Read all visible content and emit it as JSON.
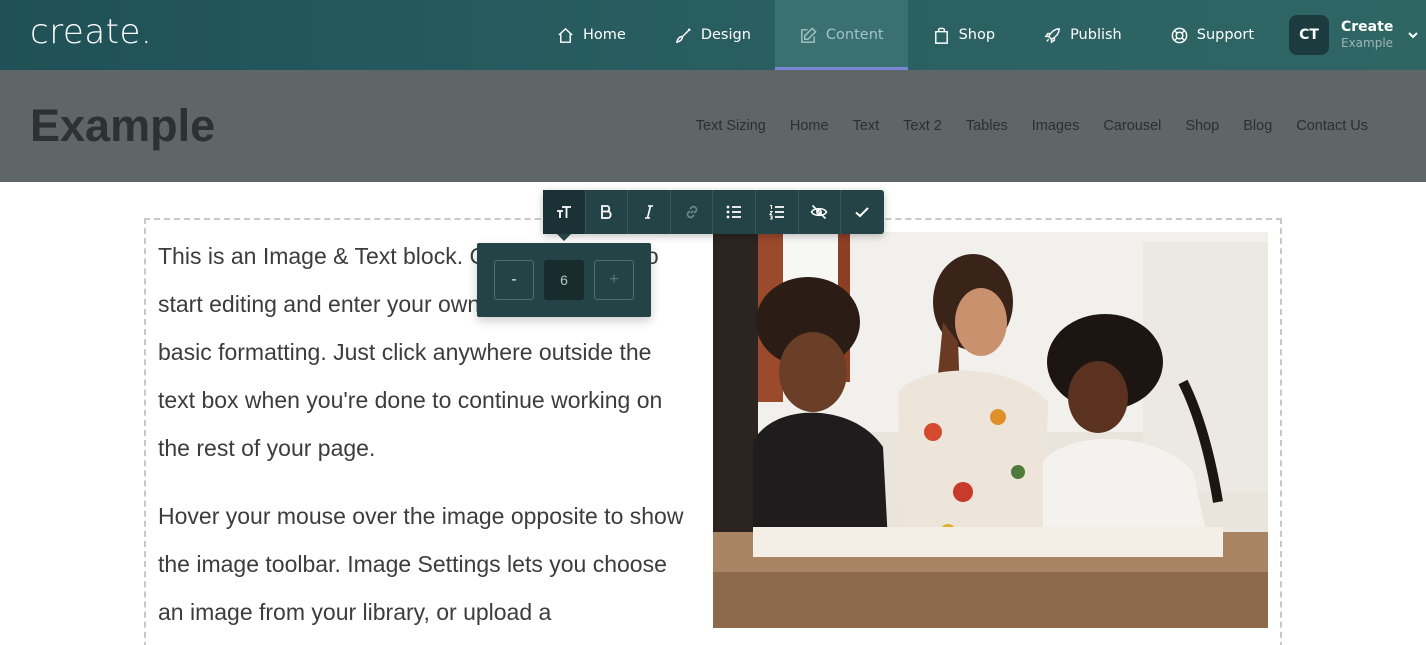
{
  "app": {
    "logo": "create.",
    "nav": [
      {
        "label": "Home",
        "icon": "home-icon"
      },
      {
        "label": "Design",
        "icon": "brush-icon"
      },
      {
        "label": "Content",
        "icon": "edit-icon",
        "active": true
      },
      {
        "label": "Shop",
        "icon": "bag-icon"
      },
      {
        "label": "Publish",
        "icon": "rocket-icon"
      },
      {
        "label": "Support",
        "icon": "lifebuoy-icon"
      }
    ],
    "user": {
      "initials": "CT",
      "name": "Create",
      "sub": "Example"
    }
  },
  "site": {
    "title": "Example",
    "nav": [
      "Text Sizing",
      "Home",
      "Text",
      "Text 2",
      "Tables",
      "Images",
      "Carousel",
      "Shop",
      "Blog",
      "Contact Us"
    ]
  },
  "block": {
    "paragraph1": "This is an Image & Text block. Click on the text to start editing and enter your own text with some basic formatting. Just click anywhere outside the text box when you're done to continue working on the rest of your page.",
    "paragraph2": "Hover your mouse over the image opposite to show the image toolbar. Image Settings lets you choose an image from your library, or upload a"
  },
  "toolbar": {
    "buttons": [
      "text-size-icon",
      "bold-icon",
      "italic-icon",
      "link-icon",
      "bullet-list-icon",
      "numbered-list-icon",
      "hide-icon",
      "check-icon"
    ]
  },
  "size_popover": {
    "minus_label": "-",
    "value": "6",
    "plus_label": "+"
  },
  "colors": {
    "topbar": "#265a5e",
    "active_underline": "#7a86d6",
    "site_header": "#5f6667",
    "toolbar": "#234346"
  }
}
